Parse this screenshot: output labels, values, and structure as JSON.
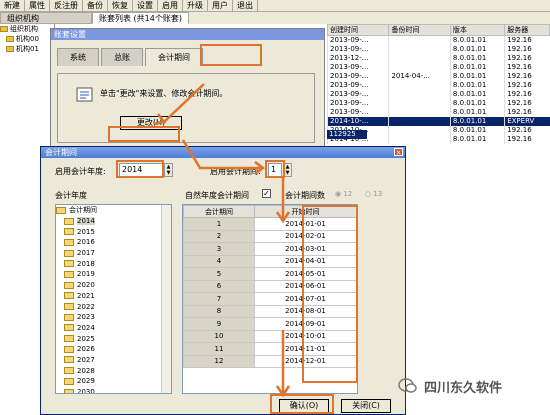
{
  "menubar": [
    "新建",
    "属性",
    "反注册",
    "备份",
    "恢复",
    "设置",
    "启用",
    "升级",
    "用户",
    "退出"
  ],
  "top_tabs": [
    "组织机构",
    "账套列表 (共14个账套)"
  ],
  "tree": [
    "组织机构",
    "机构00",
    "机构01"
  ],
  "grid": {
    "headers": [
      "创建时间",
      "备份时间",
      "版本",
      "服务器"
    ],
    "rows": [
      [
        "2013-09-...",
        "",
        "8.0.01.01",
        "192.16"
      ],
      [
        "2013-09-...",
        "",
        "8.0.01.01",
        "192.16"
      ],
      [
        "2013-12-...",
        "",
        "8.0.01.01",
        "192.16"
      ],
      [
        "2013-09-...",
        "",
        "8.0.01.01",
        "192.16"
      ],
      [
        "2013-09-...",
        "2014-04-...",
        "8.0.01.01",
        "192.16"
      ],
      [
        "2013-09-...",
        "",
        "8.0.01.01",
        "192.16"
      ],
      [
        "2013-09-...",
        "",
        "8.0.01.01",
        "192.16"
      ],
      [
        "2013-09-...",
        "",
        "8.0.01.01",
        "192.16"
      ],
      [
        "2013-09-...",
        "",
        "8.0.01.01",
        "192.16"
      ],
      [
        "2014-10-...",
        "",
        "8.0.01.01",
        "EXPERV"
      ],
      [
        "2014-10-...",
        "",
        "8.0.01.01",
        "192.16"
      ],
      [
        "2014-10-...",
        "",
        "8.0.01.01",
        "192.16"
      ]
    ],
    "selected_row": 9,
    "selected_label": "112925"
  },
  "bg_dialog": {
    "title": "账套设置",
    "tabs": [
      "系统",
      "总账",
      "会计期间"
    ],
    "message": "单击\"更改\"来设置、修改会计期间。",
    "change_button": "更改(H)"
  },
  "dialog": {
    "title": "会计期间",
    "start_year_label": "启用会计年度:",
    "start_year_value": "2014",
    "start_period_label": "启用会计期间:",
    "start_period_value": "1",
    "year_section_label": "会计年度",
    "natural_year_label": "自然年度会计期间",
    "period_count_label": "会计期间数",
    "radio_12": "12",
    "radio_13": "13",
    "year_tree_root": "会计期间",
    "years": [
      "2014",
      "2015",
      "2016",
      "2017",
      "2018",
      "2019",
      "2020",
      "2021",
      "2022",
      "2023",
      "2024",
      "2025",
      "2026",
      "2027",
      "2028",
      "2029",
      "2030"
    ],
    "table_headers": [
      "会计期间",
      "开始时间"
    ],
    "periods": [
      [
        "1",
        "2014-01-01"
      ],
      [
        "2",
        "2014-02-01"
      ],
      [
        "3",
        "2014-03-01"
      ],
      [
        "4",
        "2014-04-01"
      ],
      [
        "5",
        "2014-05-01"
      ],
      [
        "6",
        "2014-06-01"
      ],
      [
        "7",
        "2014-07-01"
      ],
      [
        "8",
        "2014-08-01"
      ],
      [
        "9",
        "2014-09-01"
      ],
      [
        "10",
        "2014-10-01"
      ],
      [
        "11",
        "2014-11-01"
      ],
      [
        "12",
        "2014-12-01"
      ]
    ],
    "ok_button": "确认(O)",
    "close_button": "关闭(C)"
  },
  "watermark": "四川东久软件",
  "colors": {
    "accent": "#e0742c",
    "title_bar": "#4f7ed9",
    "selection": "#0a246a"
  }
}
